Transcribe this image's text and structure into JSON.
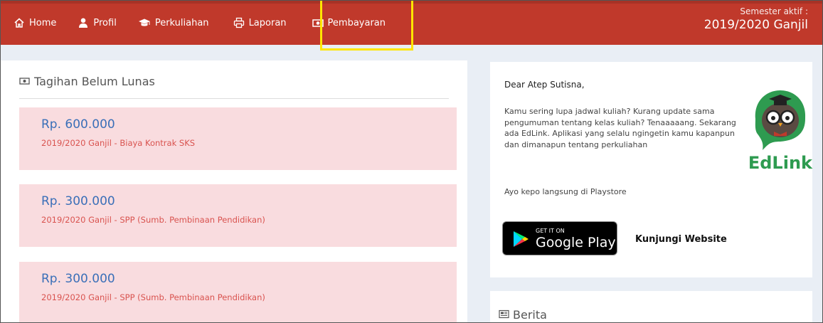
{
  "nav": {
    "items": [
      {
        "label": "Home",
        "icon": "home-icon"
      },
      {
        "label": "Profil",
        "icon": "user-icon"
      },
      {
        "label": "Perkuliahan",
        "icon": "graduation-cap-icon"
      },
      {
        "label": "Laporan",
        "icon": "print-icon"
      },
      {
        "label": "Pembayaran",
        "icon": "money-icon"
      }
    ],
    "highlighted": "Pembayaran"
  },
  "semester": {
    "label": "Semester aktif :",
    "value": "2019/2020 Ganjil"
  },
  "bills": {
    "title": "Tagihan Belum Lunas",
    "items": [
      {
        "amount": "Rp. 600.000",
        "desc": "2019/2020 Ganjil - Biaya Kontrak SKS"
      },
      {
        "amount": "Rp. 300.000",
        "desc": "2019/2020 Ganjil - SPP (Sumb. Pembinaan Pendidikan)"
      },
      {
        "amount": "Rp. 300.000",
        "desc": "2019/2020 Ganjil - SPP (Sumb. Pembinaan Pendidikan)"
      }
    ]
  },
  "promo": {
    "greeting": "Dear Atep Sutisna,",
    "message": "Kamu sering lupa jadwal kuliah? Kurang update sama pengumuman tentang kelas kuliah? Tenaaaaang. Sekarang ada EdLink. Aplikasi yang selalu ngingetin kamu kapanpun dan dimanapun tentang perkuliahan",
    "cta": "Ayo kepo langsung di Playstore",
    "play_small": "GET IT ON",
    "play_big": "Google Play",
    "website_link": "Kunjungi Website",
    "logo_text": "EdLink"
  },
  "news": {
    "title": "Berita"
  },
  "colors": {
    "topbar": "#c0392b",
    "highlight": "#ffe600",
    "bill_bg": "#f9dcdf",
    "amount": "#3a6fb8",
    "desc": "#d9534f",
    "edlink_green": "#2e9b50"
  }
}
